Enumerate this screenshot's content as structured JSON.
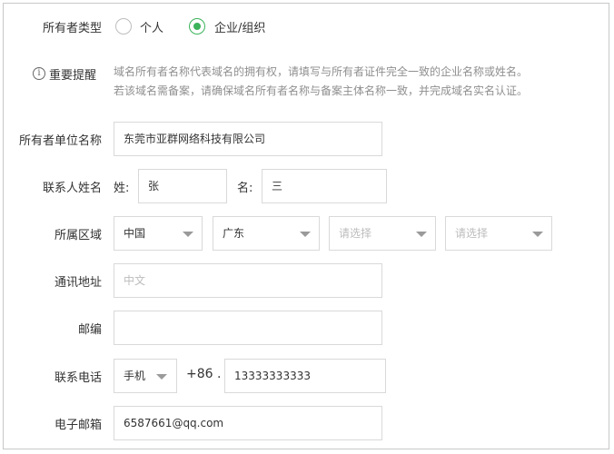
{
  "owner_type": {
    "label": "所有者类型",
    "options": [
      {
        "label": "个人",
        "selected": false
      },
      {
        "label": "企业/组织",
        "selected": true
      }
    ]
  },
  "notice": {
    "icon": "info-icon",
    "title": "重要提醒",
    "line1": "域名所有者名称代表域名的拥有权，请填写与所有者证件完全一致的企业名称或姓名。",
    "line2": "若该域名需备案，请确保域名所有者名称与备案主体名称一致，并完成域名实名认证。"
  },
  "org_name": {
    "label": "所有者单位名称",
    "value": "东莞市亚群网络科技有限公司"
  },
  "contact": {
    "label": "联系人姓名",
    "surname_label": "姓:",
    "surname": "张",
    "given_label": "名:",
    "given": "三"
  },
  "region": {
    "label": "所属区域",
    "country": "中国",
    "province": "广东",
    "city_placeholder": "请选择",
    "district_placeholder": "请选择"
  },
  "address": {
    "label": "通讯地址",
    "placeholder": "中文"
  },
  "postcode": {
    "label": "邮编",
    "value": ""
  },
  "phone": {
    "label": "联系电话",
    "type": "手机",
    "prefix": "+86 .",
    "number": "13333333333"
  },
  "email": {
    "label": "电子邮箱",
    "value": "6587661@qq.com"
  },
  "colors": {
    "accent": "#3bb35a",
    "border": "#d9d9d9",
    "placeholder": "#bcbcbc"
  }
}
